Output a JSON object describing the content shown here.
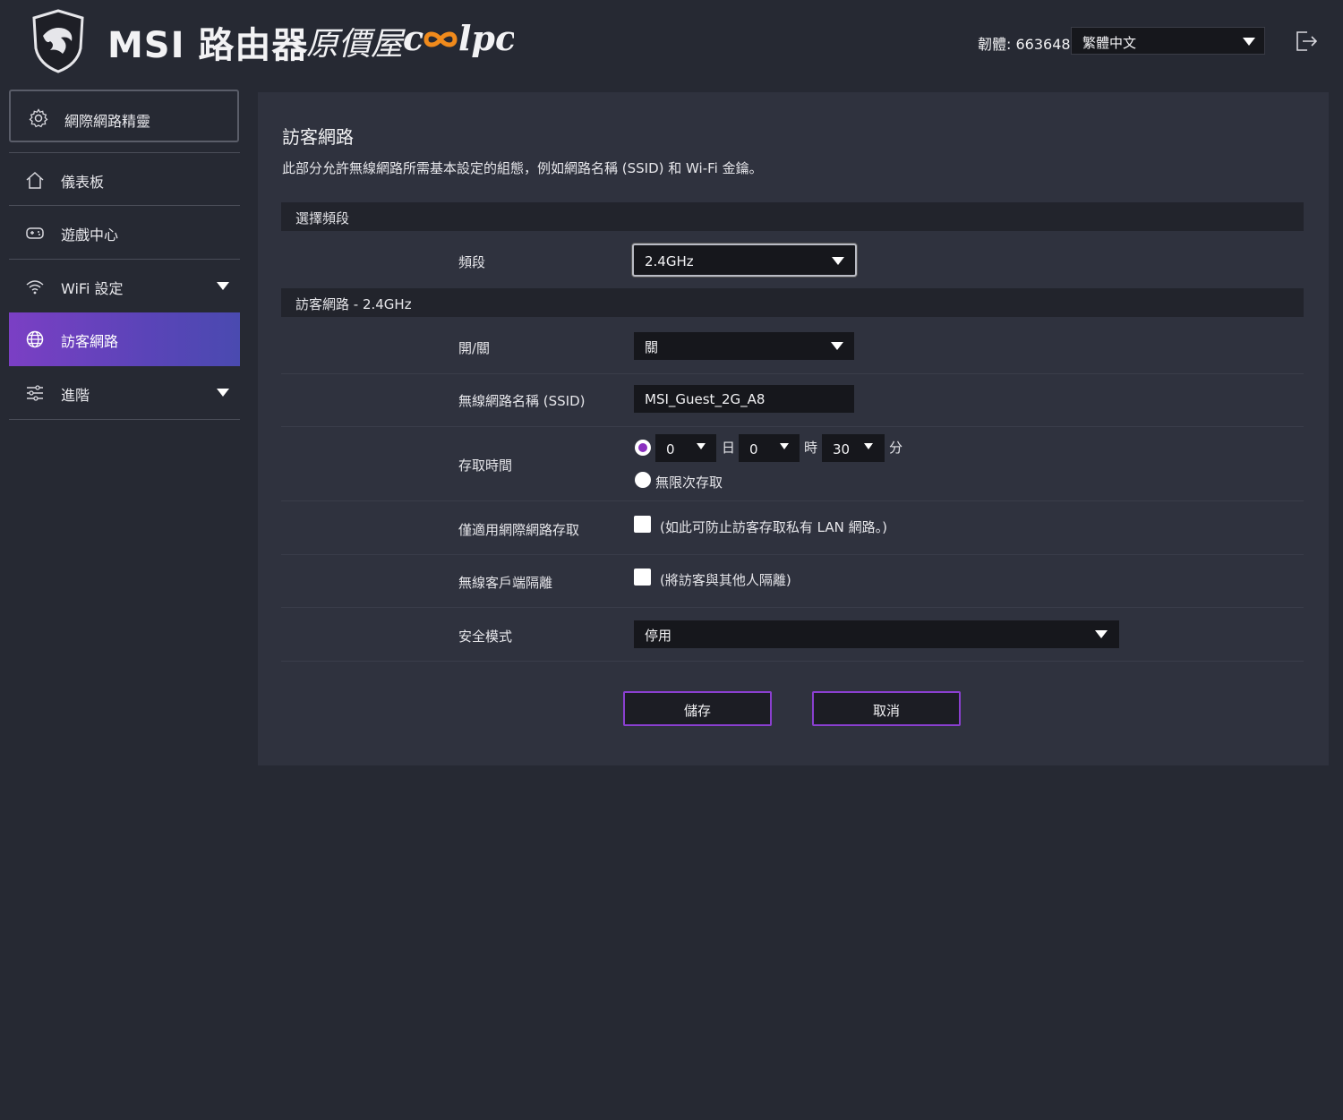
{
  "header": {
    "brand": "MSI 路由器",
    "partner_cjk": "原價屋",
    "partner_logo_text": "coolpc",
    "firmware_label": "韌體: 663648",
    "language_selected": "繁體中文"
  },
  "sidebar": {
    "items": [
      {
        "label": "網際網路精靈",
        "icon": "gear-icon"
      },
      {
        "label": "儀表板",
        "icon": "home-icon"
      },
      {
        "label": "遊戲中心",
        "icon": "gamepad-icon"
      },
      {
        "label": "WiFi 設定",
        "icon": "wifi-icon"
      },
      {
        "label": "訪客網路",
        "icon": "globe-icon",
        "active": true
      },
      {
        "label": "進階",
        "icon": "sliders-icon"
      }
    ]
  },
  "main": {
    "title": "訪客網路",
    "description": "此部分允許無線網路所需基本設定的組態，例如網路名稱 (SSID) 和 Wi-Fi 金鑰。",
    "band_section": {
      "header": "選擇頻段",
      "band_label": "頻段",
      "band_value": "2.4GHz"
    },
    "guest_section": {
      "header": "訪客網路 - 2.4GHz",
      "onoff_label": "開/關",
      "onoff_value": "關",
      "ssid_label": "無線網路名稱 (SSID)",
      "ssid_value": "MSI_Guest_2G_A8",
      "access_time_label": "存取時間",
      "days_value": "0",
      "days_unit": "日",
      "hours_value": "0",
      "hours_unit": "時",
      "minutes_value": "30",
      "minutes_unit": "分",
      "unlimited_label": "無限次存取",
      "internet_only_label": "僅適用網際網路存取",
      "internet_only_hint": "(如此可防止訪客存取私有 LAN 網路。)",
      "isolation_label": "無線客戶端隔離",
      "isolation_hint": "(將訪客與其他人隔離)",
      "security_label": "安全模式",
      "security_value": "停用"
    },
    "buttons": {
      "save": "儲存",
      "cancel": "取消"
    }
  },
  "colors": {
    "background": "#262933",
    "panel": "#2f323e",
    "accent": "#8a3fcf",
    "active_nav_gradient_start": "#7b3fc4",
    "active_nav_gradient_end": "#4a4ab0"
  }
}
